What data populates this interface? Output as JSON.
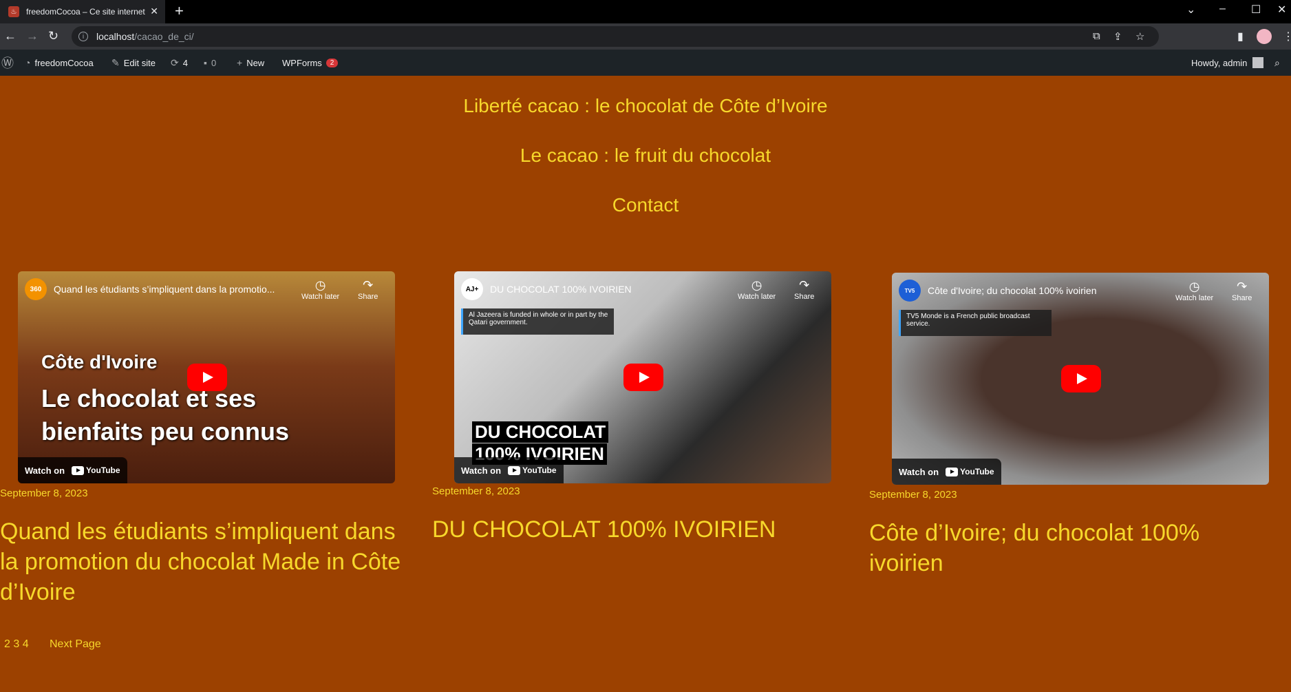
{
  "browser": {
    "tab_title": "freedomCocoa – Ce site internet",
    "url_host": "localhost",
    "url_path": "/cacao_de_ci/"
  },
  "admin_bar": {
    "site_name": "freedomCocoa",
    "edit_site": "Edit site",
    "updates_count": "4",
    "comments_count": "0",
    "new_label": "New",
    "wpforms_label": "WPForms",
    "wpforms_badge": "2",
    "howdy": "Howdy, admin"
  },
  "nav": {
    "items": [
      "Liberté cacao : le chocolat de Côte d’Ivoire",
      "Le cacao : le fruit du chocolat",
      "Contact"
    ]
  },
  "posts": [
    {
      "video_channel": "360 Afrique",
      "video_title": "Quand les étudiants s’impliquent dans la promotio...",
      "overlay_line1": "Côte d'Ivoire",
      "overlay_line2": "Le chocolat et ses",
      "overlay_line3": "bienfaits peu connus",
      "watch_later": "Watch later",
      "share": "Share",
      "watch_on": "Watch on",
      "youtube": "YouTube",
      "date": "September 8, 2023",
      "title": "Quand les étudiants s’impliquent dans la promotion du chocolat Made in Côte d’Ivoire"
    },
    {
      "video_channel": "AJ+",
      "video_title": "DU CHOCOLAT 100% IVOIRIEN",
      "notice": "Al Jazeera is funded in whole or in part by the Qatari government.",
      "overlay_line1": "DU CHOCOLAT",
      "overlay_line2": "100% IVOIRIEN",
      "watch_later": "Watch later",
      "share": "Share",
      "watch_on": "Watch on",
      "youtube": "YouTube",
      "date": "September 8, 2023",
      "title": "DU CHOCOLAT 100% IVOIRIEN"
    },
    {
      "video_channel": "TV5 MONDE",
      "video_title": "Côte d'Ivoire; du chocolat 100% ivoirien",
      "notice": "TV5 Monde is a French public broadcast service.",
      "watch_later": "Watch later",
      "share": "Share",
      "watch_on": "Watch on",
      "youtube": "YouTube",
      "date": "September 8, 2023",
      "title": "Côte d’Ivoire; du chocolat 100% ivoirien"
    }
  ],
  "pagination": {
    "pages": "2 3 4",
    "next": "Next Page"
  },
  "colors": {
    "background": "#9c4100",
    "link": "#f7d82b"
  }
}
